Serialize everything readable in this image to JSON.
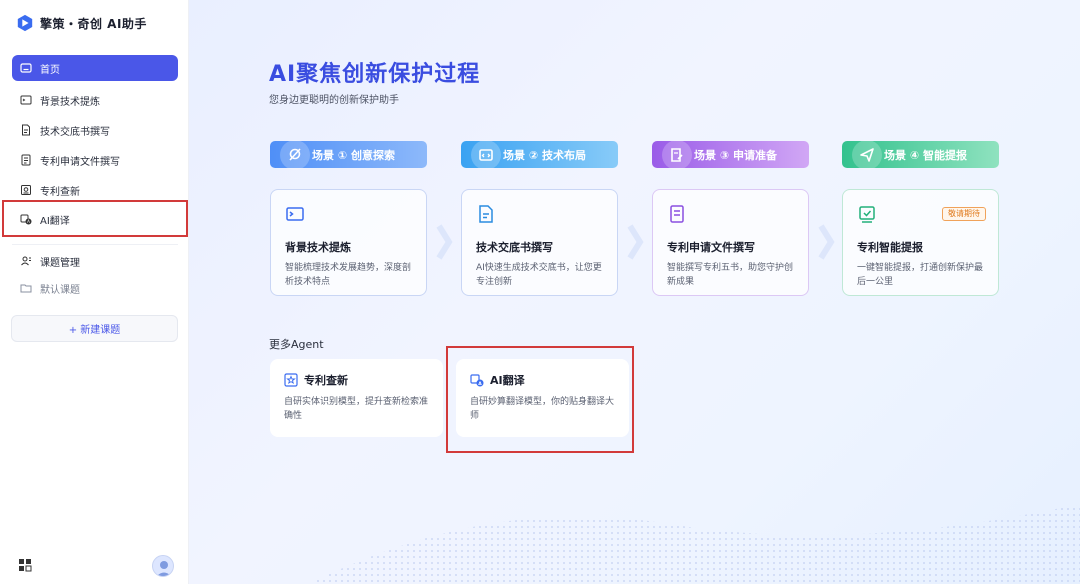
{
  "brand": {
    "title": "擎策・奇创 AI助手"
  },
  "sidebar": {
    "items": [
      {
        "label": "首页",
        "icon": "home-icon"
      },
      {
        "label": "背景技术提炼",
        "icon": "terminal-icon"
      },
      {
        "label": "技术交底书撰写",
        "icon": "doc-edit-icon"
      },
      {
        "label": "专利申请文件撰写",
        "icon": "doc-list-icon"
      },
      {
        "label": "专利查新",
        "icon": "search-doc-icon"
      },
      {
        "label": "AI翻译",
        "icon": "translate-icon"
      }
    ],
    "topic_manage": "课题管理",
    "default_topic": "默认课题",
    "new_topic": "+ 新建课题"
  },
  "hero": {
    "title": "AI聚焦创新保护过程",
    "subtitle": "您身边更聪明的创新保护助手"
  },
  "scenes": [
    {
      "label": "场景 ① 创意探索",
      "color_from": "#4f8ff7",
      "color_to": "#8db9fa",
      "card_title": "背景技术提炼",
      "card_desc": "智能梳理技术发展趋势，深度剖析技术特点",
      "icon": "terminal-icon"
    },
    {
      "label": "场景 ② 技术布局",
      "color_from": "#3aa2f2",
      "color_to": "#88cbf8",
      "card_title": "技术交底书撰写",
      "card_desc": "AI快速生成技术交底书，让您更专注创新",
      "icon": "doc-edit-icon"
    },
    {
      "label": "场景 ③ 申请准备",
      "color_from": "#9a5ce8",
      "color_to": "#d1a7f5",
      "card_title": "专利申请文件撰写",
      "card_desc": "智能撰写专利五书，助您守护创新成果",
      "icon": "doc-list-icon"
    },
    {
      "label": "场景 ④ 智能提报",
      "color_from": "#33c28e",
      "color_to": "#8fe2bf",
      "card_title": "专利智能提报",
      "card_desc": "一键智能提报，打通创新保护最后一公里",
      "icon": "check-box-icon",
      "badge": "敬请期待"
    }
  ],
  "more": {
    "label": "更多Agent",
    "agents": [
      {
        "title": "专利查新",
        "desc": "自研实体识别模型，提升查新检索准确性",
        "icon": "star-box-icon"
      },
      {
        "title": "AI翻译",
        "desc": "自研妙算翻译模型，你的贴身翻译大师",
        "icon": "translate-icon"
      }
    ]
  }
}
